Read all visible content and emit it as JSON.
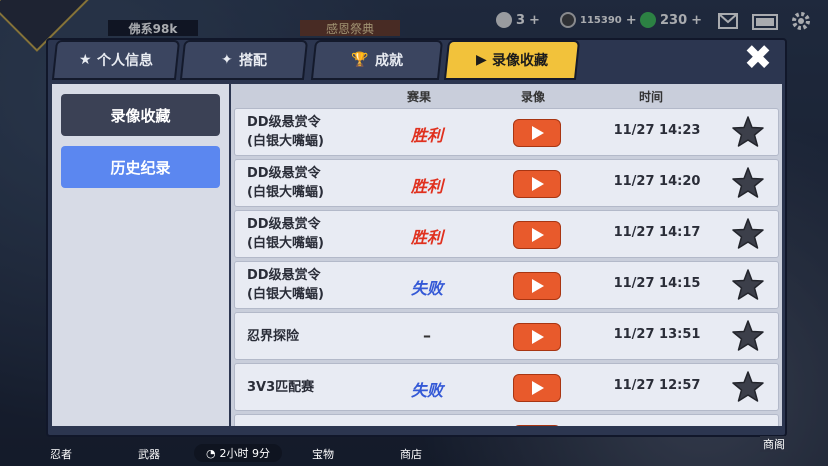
{
  "topbar": {
    "power_label": "佛系98k",
    "banner_label": "感恩祭典",
    "currency_a": "3",
    "currency_b": "115390",
    "currency_c": "230",
    "plus": "+"
  },
  "tabs": [
    {
      "label": "个人信息"
    },
    {
      "label": "搭配"
    },
    {
      "label": "成就"
    },
    {
      "label": "录像收藏"
    }
  ],
  "sidebar": {
    "items": [
      {
        "label": "录像收藏"
      },
      {
        "label": "历史纪录"
      }
    ]
  },
  "table": {
    "headers": {
      "result": "赛果",
      "video": "录像",
      "time": "时间"
    },
    "rows": [
      {
        "name1": "DD级悬赏令",
        "name2": "(白银大嘴蝠)",
        "result": "胜利",
        "type": "win",
        "time": "11/27 14:23"
      },
      {
        "name1": "DD级悬赏令",
        "name2": "(白银大嘴蝠)",
        "result": "胜利",
        "type": "win",
        "time": "11/27 14:20"
      },
      {
        "name1": "DD级悬赏令",
        "name2": "(白银大嘴蝠)",
        "result": "胜利",
        "type": "win",
        "time": "11/27 14:17"
      },
      {
        "name1": "DD级悬赏令",
        "name2": "(白银大嘴蝠)",
        "result": "失败",
        "type": "lose",
        "time": "11/27 14:15"
      },
      {
        "name1": "忍界探险",
        "name2": "",
        "result": "–",
        "type": "none",
        "time": "11/27 13:51"
      },
      {
        "name1": "3V3匹配赛",
        "name2": "",
        "result": "失败",
        "type": "lose",
        "time": "11/27 12:57"
      }
    ]
  },
  "bottom": {
    "timer": "2小时 9分",
    "nav": [
      "忍者",
      "武器",
      "宝物",
      "商店"
    ],
    "right_label": "商阁"
  },
  "colors": {
    "accent": "#f2c23b",
    "play": "#e85a2c",
    "win": "#e0301e",
    "lose": "#3459d6",
    "side_selected": "#3b4155",
    "side_normal": "#5b87f0"
  }
}
